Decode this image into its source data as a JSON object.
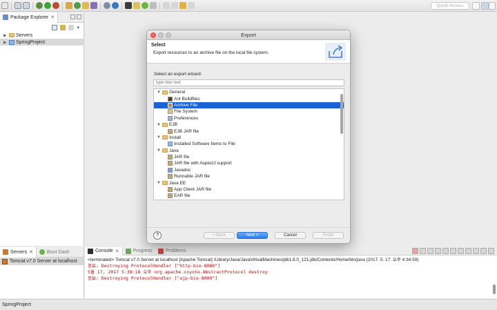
{
  "toolbar": {
    "quick_access_placeholder": "Quick Access"
  },
  "package_explorer": {
    "tab_label": "Package Explorer",
    "tab_close": "✕",
    "items": [
      {
        "label": "Servers"
      },
      {
        "label": "SpringProject"
      }
    ]
  },
  "servers_view": {
    "tab_label": "Servers",
    "tab_close": "✕",
    "tab2_label": "Boot Dash",
    "server_item": "Tomcat v7.0 Server at localhost"
  },
  "console_view": {
    "tab_label": "Console",
    "tab_close": "✕",
    "tab2_label": "Progress",
    "tab3_label": "Problems",
    "header": "<terminated> Tomcat v7.0 Server at localhost [Apache Tomcat] /Library/Java/JavaVirtualMachines/jdk1.8.0_121.jdk/Contents/Home/bin/java (2017. 5. 17. 오후 4:34:59)",
    "lines": [
      "정보: Destroying ProtocolHandler [\"http-bio-8080\"]",
      "5월 17, 2017 5:38:18 오후 org.apache.coyote.AbstractProtocol destroy",
      "정보: Destroying ProtocolHandler [\"ajp-bio-8009\"]"
    ]
  },
  "statusbar": {
    "text": "SpringProject"
  },
  "dialog": {
    "title": "Export",
    "header_title": "Select",
    "header_desc": "Export resources to an archive file on the local file system.",
    "wizard_label": "Select an export wizard:",
    "filter_placeholder": "type filter text",
    "tree": [
      {
        "label": "General",
        "level": 0
      },
      {
        "label": "Ant Buildfiles",
        "level": 1
      },
      {
        "label": "Archive File",
        "level": 1,
        "selected": true
      },
      {
        "label": "File System",
        "level": 1
      },
      {
        "label": "Preferences",
        "level": 1
      },
      {
        "label": "EJB",
        "level": 0
      },
      {
        "label": "EJB JAR file",
        "level": 1
      },
      {
        "label": "Install",
        "level": 0
      },
      {
        "label": "Installed Software Items to File",
        "level": 1
      },
      {
        "label": "Java",
        "level": 0
      },
      {
        "label": "JAR file",
        "level": 1
      },
      {
        "label": "JAR file with AspectJ support",
        "level": 1
      },
      {
        "label": "Javadoc",
        "level": 1
      },
      {
        "label": "Runnable JAR file",
        "level": 1
      },
      {
        "label": "Java EE",
        "level": 0
      },
      {
        "label": "App Client JAR file",
        "level": 1
      },
      {
        "label": "EAR file",
        "level": 1
      }
    ],
    "help_label": "?",
    "back_label": "< Back",
    "next_label": "Next >",
    "cancel_label": "Cancel",
    "finish_label": "Finish"
  },
  "colors": {
    "selection": "#1a62d6",
    "console_error": "#d00000",
    "primary_button": "#2a7ef0"
  }
}
